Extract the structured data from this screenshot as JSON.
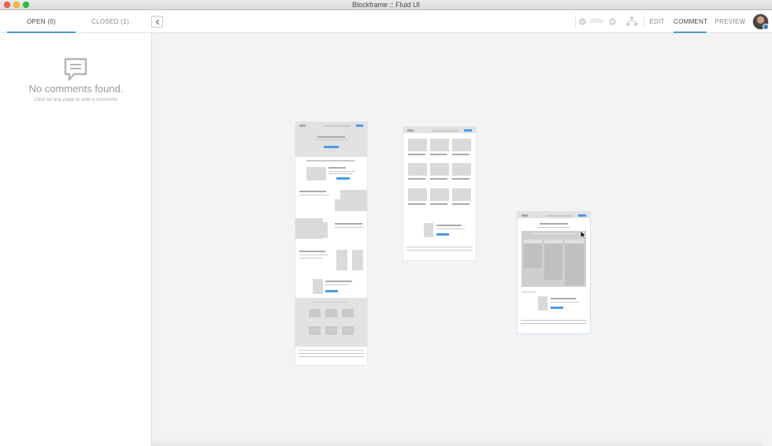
{
  "window": {
    "title": "Blockframe :: Fluid UI"
  },
  "tabs": {
    "open_label": "OPEN (0)",
    "closed_label": "CLOSED (1)"
  },
  "zoom": {
    "level": "100%"
  },
  "modes": {
    "edit": "EDIT",
    "comment": "COMMENT",
    "preview": "PREVIEW",
    "active": "COMMENT"
  },
  "empty_state": {
    "title": "No comments found.",
    "subtitle": "Click on any page to add a comment."
  },
  "colors": {
    "accent": "#4a9ad6",
    "wire_button": "#4a9ae6",
    "wire_block": "#dadada"
  },
  "icons": {
    "collapse": "chevron-left-icon",
    "zoom_out": "zoom-out-icon",
    "zoom_in": "zoom-in-icon",
    "sitemap": "sitemap-icon",
    "empty": "comment-bubble-icon",
    "cursor": "mouse-cursor-icon"
  }
}
